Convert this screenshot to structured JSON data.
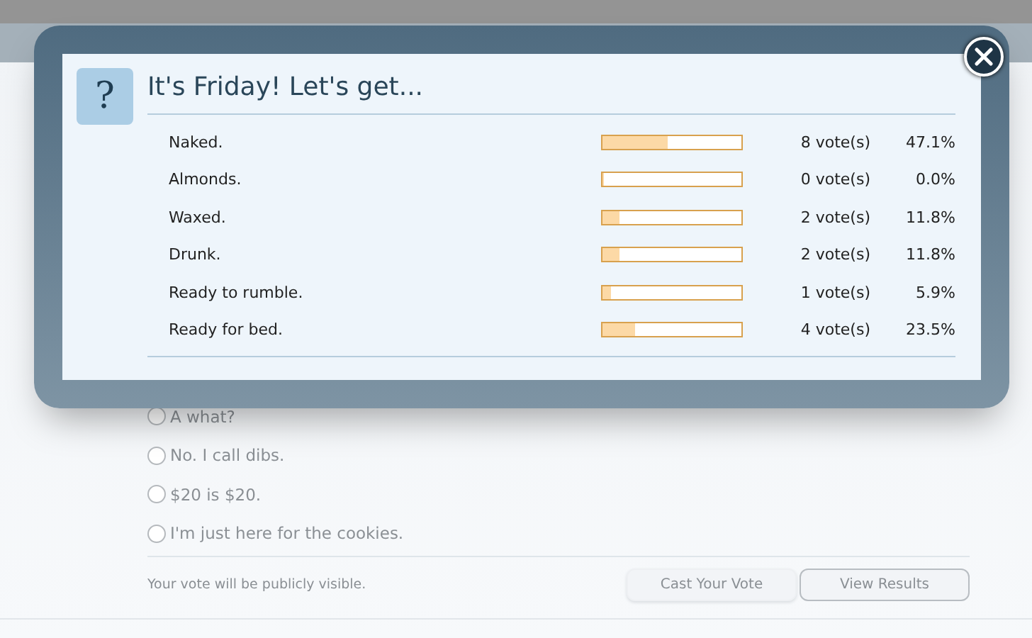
{
  "poll": {
    "icon": "?",
    "title": "It's Friday! Let's get...",
    "results": [
      {
        "label": "Naked.",
        "level": 0.471,
        "votes": "8 vote(s)",
        "percent": "47.1%"
      },
      {
        "label": "Almonds.",
        "level": 0,
        "votes": "0 vote(s)",
        "percent": "0.0%"
      },
      {
        "label": "Waxed.",
        "level": 0.118,
        "votes": "2 vote(s)",
        "percent": "11.8%"
      },
      {
        "label": "Drunk.",
        "level": 0.118,
        "votes": "2 vote(s)",
        "percent": "11.8%"
      },
      {
        "label": "Ready to rumble.",
        "level": 0.059,
        "votes": "1 vote(s)",
        "percent": "5.9%"
      },
      {
        "label": "Ready for bed.",
        "level": 0.235,
        "votes": "4 vote(s)",
        "percent": "23.5%"
      }
    ]
  },
  "background": {
    "options": [
      {
        "label": "A what?",
        "selected": false
      },
      {
        "label": "No. I call dibs.",
        "selected": false
      },
      {
        "label": "$20 is $20.",
        "selected": false
      },
      {
        "label": "I'm just here for the cookies.",
        "selected": false
      }
    ],
    "note": "Your vote will be publicly visible.",
    "buttons": [
      {
        "label": "Cast Your Vote",
        "kind": "plain"
      },
      {
        "label": "View Results",
        "kind": "outline"
      }
    ]
  }
}
